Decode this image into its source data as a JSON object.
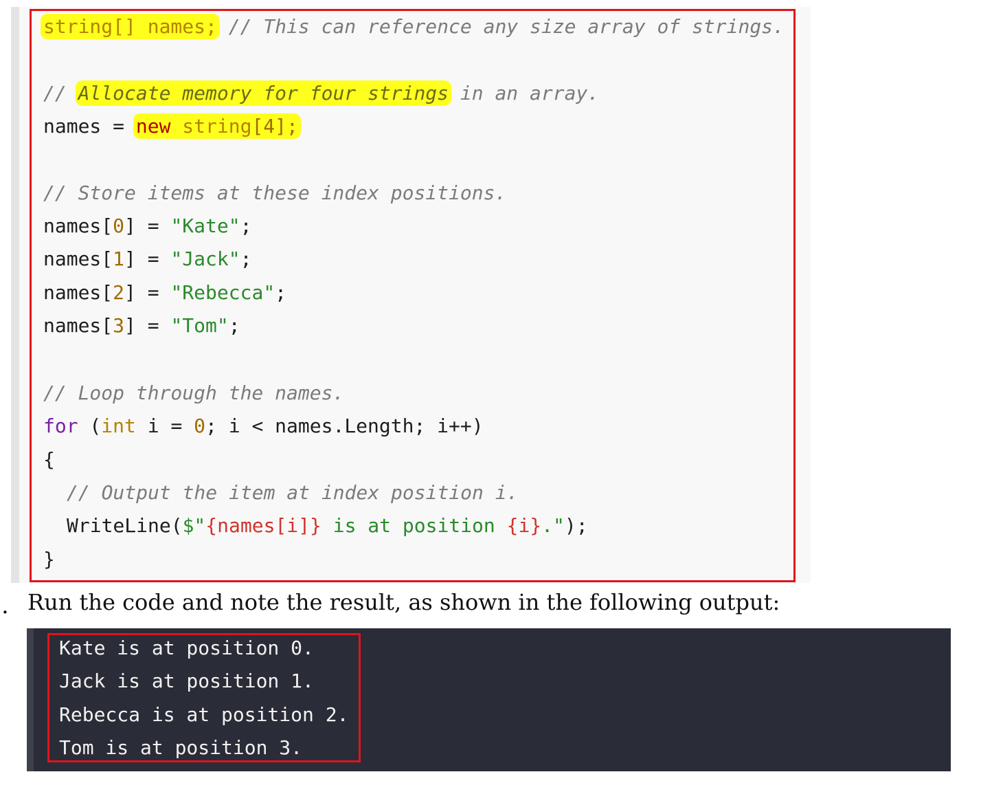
{
  "code": {
    "l1_a": "string[] names;",
    "l1_b": " // This can reference any size array of strings.",
    "l2_a": "// ",
    "l2_b": "Allocate memory for four strings",
    "l2_c": " in an array.",
    "l3_a": "names = ",
    "l3_new": "new",
    "l3_type": "string",
    "l3_num": "[4];",
    "l4": "// Store items at these index positions.",
    "l5_a": "names[",
    "l5_i": "0",
    "l5_b": "] = ",
    "l5_s": "\"Kate\"",
    "l6_a": "names[",
    "l6_i": "1",
    "l6_b": "] = ",
    "l6_s": "\"Jack\"",
    "l7_a": "names[",
    "l7_i": "2",
    "l7_b": "] = ",
    "l7_s": "\"Rebecca\"",
    "l8_a": "names[",
    "l8_i": "3",
    "l8_b": "] = ",
    "l8_s": "\"Tom\"",
    "semicolon": ";",
    "l9": "// Loop through the names.",
    "l10_for": "for",
    "l10_p": " (",
    "l10_int": "int",
    "l10_a": " i = ",
    "l10_zero": "0",
    "l10_b": "; i < names.Length; i++)",
    "l11": "{",
    "l12": "// Output the item at index position i.",
    "l13_a": "WriteLine(",
    "l13_s1": "$\"",
    "l13_i1": "{names[i]}",
    "l13_s2": " is at position ",
    "l13_i2": "{i}",
    "l13_s3": ".\"",
    "l13_b": ");",
    "l14": "}"
  },
  "prose": {
    "marker": ".",
    "text": "Run the code and note the result, as shown in the following output:"
  },
  "output": {
    "lines": [
      "Kate is at position 0.",
      "Jack is at position 1.",
      "Rebecca is at position 2.",
      "Tom is at position 3."
    ]
  }
}
